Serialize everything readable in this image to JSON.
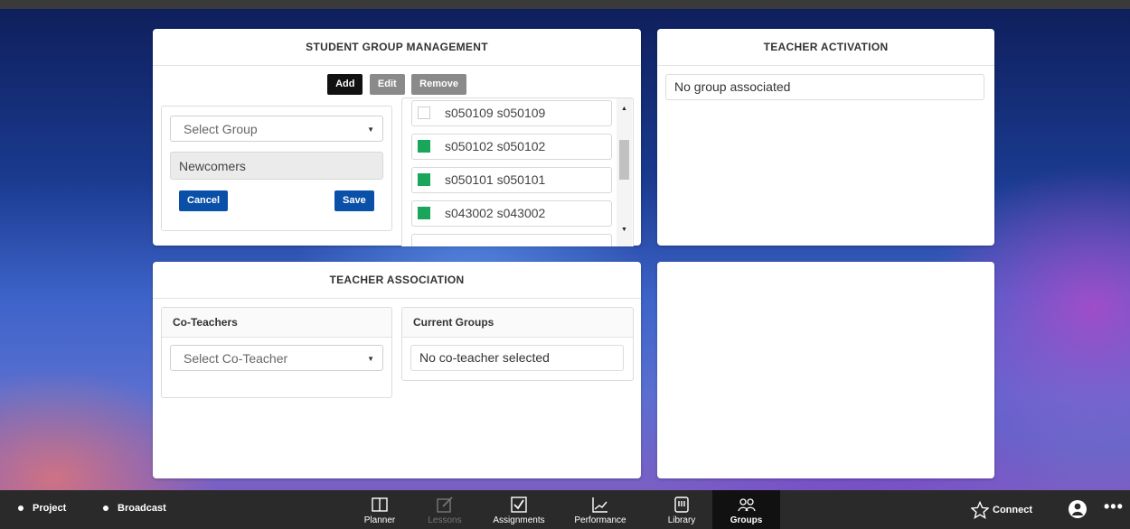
{
  "student_group_management": {
    "title": "STUDENT GROUP MANAGEMENT",
    "buttons": {
      "add": "Add",
      "edit": "Edit",
      "remove": "Remove"
    },
    "select_group_placeholder": "Select Group",
    "group_name_value": "Newcomers",
    "cancel_label": "Cancel",
    "save_label": "Save",
    "students": [
      {
        "label": "s050109 s050109",
        "checked": false
      },
      {
        "label": "s050102 s050102",
        "checked": true
      },
      {
        "label": "s050101 s050101",
        "checked": true
      },
      {
        "label": "s043002 s043002",
        "checked": true
      }
    ]
  },
  "teacher_activation": {
    "title": "TEACHER ACTIVATION",
    "status_text": "No group associated"
  },
  "teacher_association": {
    "title": "TEACHER ASSOCIATION",
    "co_teachers_header": "Co-Teachers",
    "select_co_teacher_placeholder": "Select Co-Teacher",
    "current_groups_header": "Current Groups",
    "current_groups_value": "No co-teacher selected"
  },
  "taskbar": {
    "left_items": [
      {
        "label": "Project"
      },
      {
        "label": "Broadcast"
      }
    ],
    "nav": [
      {
        "label": "Planner",
        "icon": "book-icon",
        "state": "normal"
      },
      {
        "label": "Lessons",
        "icon": "edit-icon",
        "state": "disabled"
      },
      {
        "label": "Assignments",
        "icon": "checkbox-icon",
        "state": "normal"
      },
      {
        "label": "Performance",
        "icon": "chart-icon",
        "state": "normal"
      },
      {
        "label": "Library",
        "icon": "library-icon",
        "state": "normal"
      },
      {
        "label": "Groups",
        "icon": "groups-icon",
        "state": "active"
      }
    ],
    "connect_label": "Connect",
    "colors": {
      "check_green": "#1aa65a",
      "primary_blue": "#0a4fa8"
    }
  }
}
